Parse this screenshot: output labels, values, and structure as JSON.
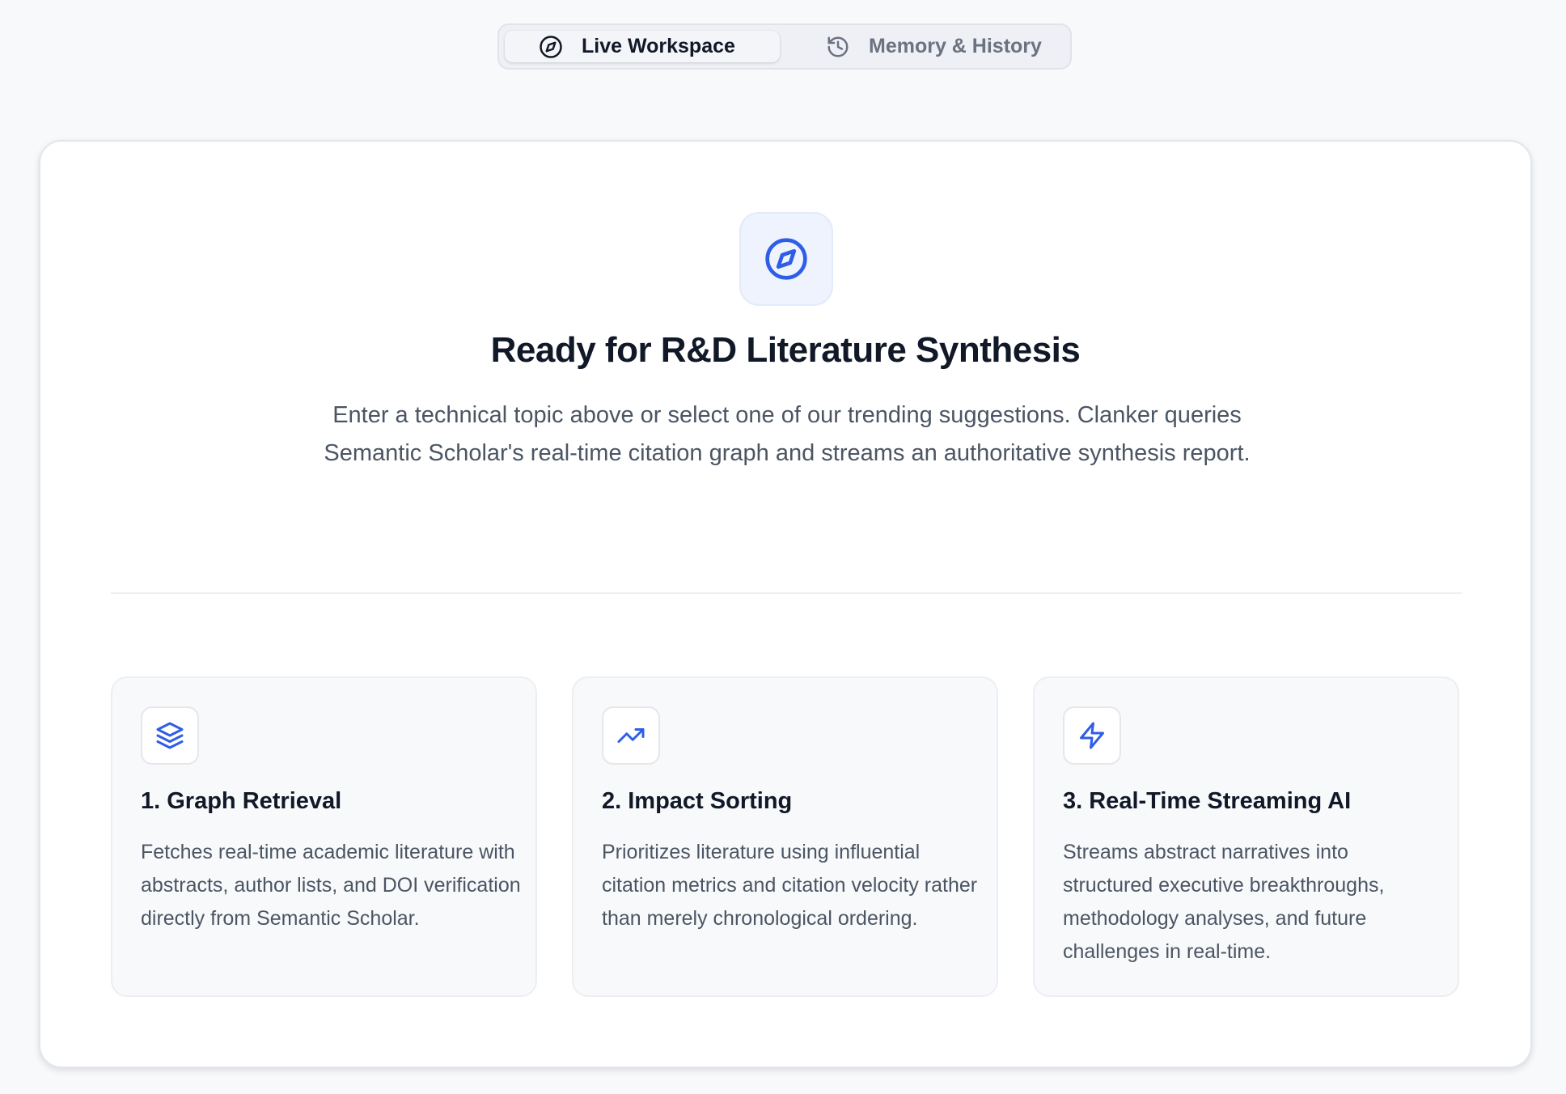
{
  "tabs": [
    {
      "label": "Live Workspace",
      "icon": "compass-icon",
      "active": true
    },
    {
      "label": "Memory & History",
      "icon": "history-icon",
      "active": false
    }
  ],
  "hero": {
    "icon": "compass-icon",
    "title": "Ready for R&D Literature Synthesis",
    "description": "Enter a technical topic above or select one of our trending suggestions. Clanker queries Semantic Scholar's real-time citation graph and streams an authoritative synthesis report."
  },
  "features": [
    {
      "icon": "layers-icon",
      "title": "1. Graph Retrieval",
      "description": "Fetches real-time academic literature with abstracts, author lists, and DOI verification directly from Semantic Scholar."
    },
    {
      "icon": "trending-up-icon",
      "title": "2. Impact Sorting",
      "description": "Prioritizes literature using influential citation metrics and citation velocity rather than merely chronological ordering."
    },
    {
      "icon": "zap-icon",
      "title": "3. Real-Time Streaming AI",
      "description": "Streams abstract narratives into structured executive breakthroughs, methodology analyses, and future challenges in real-time."
    }
  ],
  "colors": {
    "accent": "#2f5ee6",
    "background": "#f8f9fb",
    "card": "#ffffff",
    "heading": "#111827",
    "body_text": "#4b5563",
    "inactive_tab": "#6b7280"
  }
}
